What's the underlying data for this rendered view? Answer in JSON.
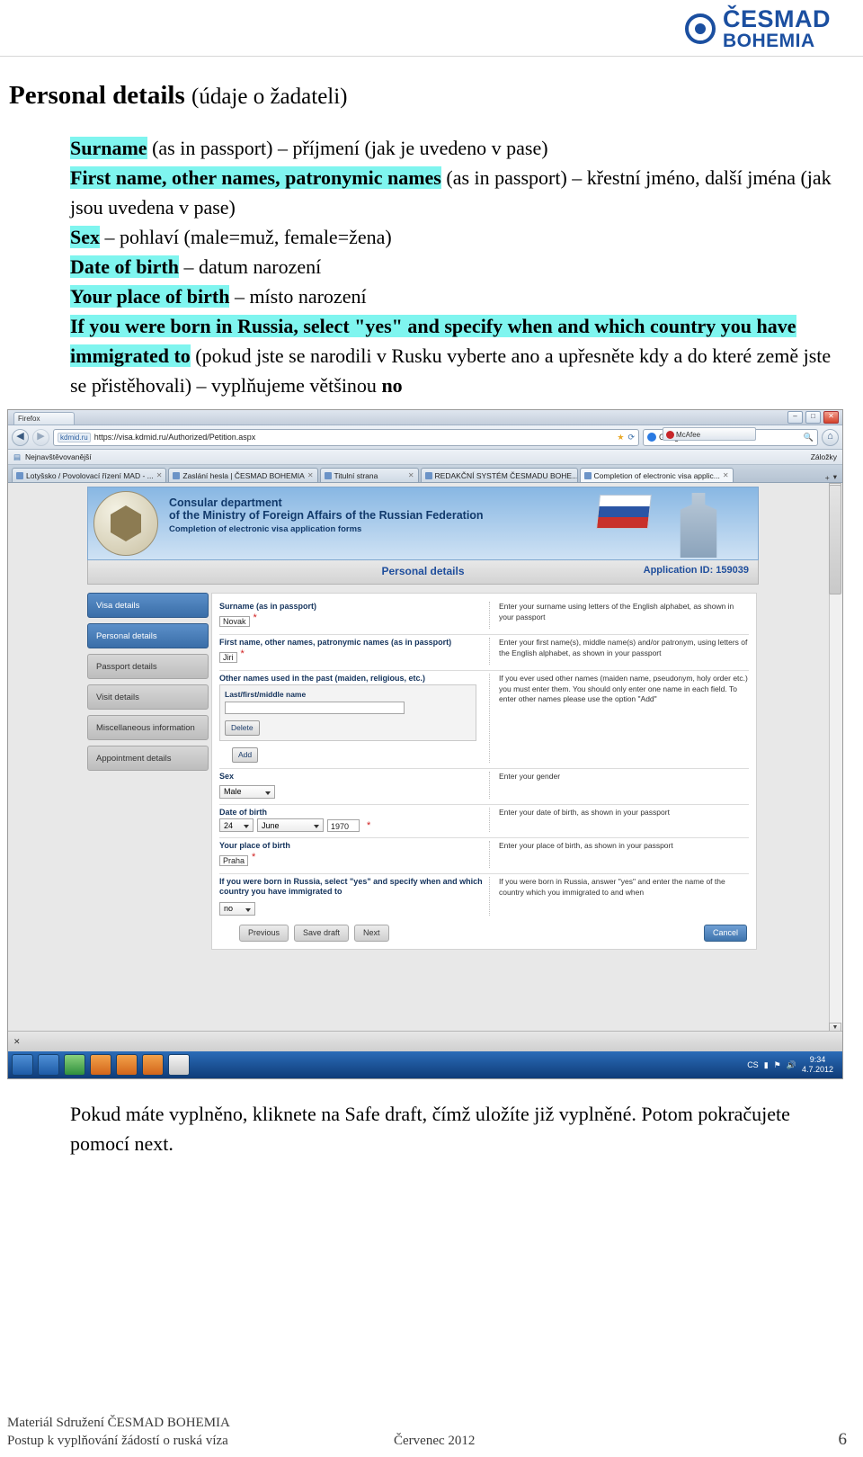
{
  "brand": {
    "line1": "ČESMAD",
    "line2": "BOHEMIA",
    "mark": "cesmad-logo"
  },
  "heading": {
    "title": "Personal details",
    "subtitle": "(údaje o žadateli)"
  },
  "intro": {
    "l1_hl": "Surname",
    "l1_rest": " (as in passport) – příjmení (jak je uvedeno v pase)",
    "l2_hl": "First name, other names, patronymic names",
    "l2_rest": " (as in passport) – křestní jméno, další jména (jak jsou uvedena v pase)",
    "l3_hl": "Sex",
    "l3_rest": " – pohlaví  (male=muž, female=žena)",
    "l4_hl": "Date of birth",
    "l4_rest": " – datum narození",
    "l5_hl": "Your place of birth",
    "l5_rest": " – místo narození",
    "l6_hl": "If you were born in Russia, select \"yes\" and specify when and which country you have immigrated to",
    "l6_rest": " (pokud jste se narodili v Rusku vyberte ano a upřesněte kdy a do které země jste se přistěhovali) – vyplňujeme většinou ",
    "l6_bold": "no"
  },
  "screenshot": {
    "browser": {
      "app_tab": "Firefox",
      "win_minimize": "–",
      "win_maximize": "□",
      "win_close": "✕",
      "back_icon": "back-arrow-icon",
      "forward_icon": "forward-arrow-icon",
      "url_chip": "kdmid.ru",
      "url": "https://visa.kdmid.ru/Authorized/Petition.aspx",
      "star_icon": "bookmark-star-icon",
      "reload_icon": "reload-icon",
      "search_engine": "Google",
      "search_placeholder": "Google",
      "go_icon": "search-icon",
      "home_icon": "home-icon",
      "mcafee": "McAfee",
      "bookmarks_label": "Nejnavštěvovanější",
      "bookmarks_right": "Záložky",
      "tabs": [
        "Lotyšsko / Povolovací řízení MAD - ...",
        "Zaslání hesla | ČESMAD BOHEMIA",
        "Titulní strana",
        "REDAKČNÍ SYSTÉM ČESMADU BOHE...",
        "Completion of electronic visa applic..."
      ],
      "active_tab_index": 4,
      "new_tab_label": "+",
      "tab_list_icon": "chevron-down-icon"
    },
    "banner": {
      "line1": "Consular department",
      "line2": "of the Ministry of Foreign Affairs of the Russian Federation",
      "line3": "Completion of electronic visa application forms",
      "emblem": "russian-coat-of-arms"
    },
    "subbar": {
      "title": "Personal details",
      "application_id": "Application ID: 159039"
    },
    "sidenav": [
      {
        "label": "Visa details",
        "state": "active"
      },
      {
        "label": "Personal details",
        "state": "active"
      },
      {
        "label": "Passport details",
        "state": "disabled"
      },
      {
        "label": "Visit details",
        "state": "disabled"
      },
      {
        "label": "Miscellaneous information",
        "state": "disabled"
      },
      {
        "label": "Appointment details",
        "state": "disabled"
      }
    ],
    "form": {
      "surname": {
        "label": "Surname (as in passport)",
        "value": "Novak",
        "required": "*",
        "hint": "Enter your surname using letters of the English alphabet, as shown in your passport"
      },
      "firstname": {
        "label": "First name, other names, patronymic names (as in passport)",
        "value": "Jiri",
        "required": "*",
        "hint": "Enter your first name(s), middle name(s) and/or patronym, using letters of the English alphabet, as shown in your passport"
      },
      "othernames": {
        "label": "Other names used in the past (maiden, religious, etc.)",
        "sublabel": "Last/first/middle name",
        "value": "",
        "delete_label": "Delete",
        "add_label": "Add",
        "hint": "If you ever used other names (maiden name, pseudonym, holy order etc.) you must enter them. You should only enter one name in each field. To enter other names please use the option \"Add\""
      },
      "sex": {
        "label": "Sex",
        "value": "Male",
        "hint": "Enter your gender"
      },
      "dob": {
        "label": "Date of birth",
        "day": "24",
        "month": "June",
        "year": "1970",
        "required": "*",
        "hint": "Enter your date of birth, as shown in your passport"
      },
      "pob": {
        "label": "Your place of birth",
        "value": "Praha",
        "required": "*",
        "hint": "Enter your place of birth, as shown in your passport"
      },
      "russia": {
        "label": "If you were born in Russia, select \"yes\" and specify when and which country you have immigrated to",
        "value": "no",
        "hint": "If you were born in Russia, answer \"yes\" and enter the name of the country which you immigrated to and when"
      },
      "buttons": {
        "previous": "Previous",
        "save_draft": "Save draft",
        "next": "Next",
        "cancel": "Cancel"
      }
    },
    "taskbar": {
      "language": "CS",
      "time": "9:34",
      "date": "4.7.2012",
      "icons": [
        "start-icon",
        "ie-icon",
        "explorer-icon",
        "firefox-icon",
        "firefox-icon-2",
        "firefox-icon-3",
        "word-icon"
      ],
      "tray_icons": [
        "network-icon",
        "volume-icon",
        "flag-icon",
        "battery-icon"
      ]
    }
  },
  "bottom_note": "Pokud máte vyplněno, kliknete na Safe draft, čímž uložíte již vyplněné. Potom pokračujete pomocí next.",
  "footer": {
    "line1": "Materiál Sdružení ČESMAD  BOHEMIA",
    "line2": "Postup k vyplňování žádostí o ruská víza",
    "date": "Červenec 2012",
    "page": "6"
  }
}
